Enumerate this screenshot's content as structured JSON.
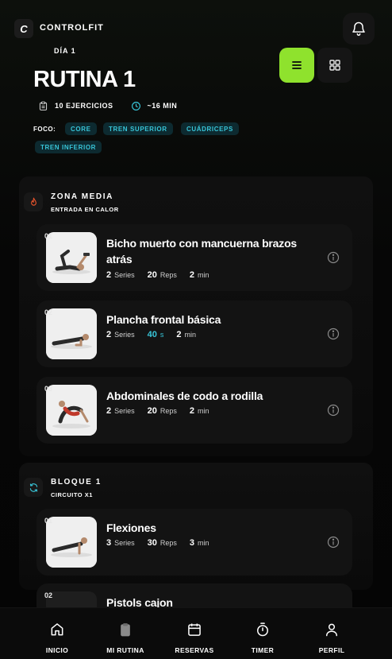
{
  "app": {
    "logo_letter": "C",
    "brand": "CONTROLFIT"
  },
  "header": {
    "day_label": "DÍA 1",
    "title": "RUTINA 1",
    "exercises_count": "10 EJERCICIOS",
    "duration": "~16 MIN",
    "focus_label": "FOCO:",
    "focus_tags": [
      "CORE",
      "TREN SUPERIOR",
      "CUÁDRICEPS",
      "TREN INFERIOR"
    ]
  },
  "view_toggle": {
    "active": "list",
    "options": [
      "list-icon",
      "grid-icon"
    ]
  },
  "sections": [
    {
      "icon": "flame-icon",
      "icon_color": "#e8532c",
      "title": "ZONA MEDIA",
      "subtitle": "ENTRADA EN CALOR",
      "exercises": [
        {
          "number": "01",
          "name": "Bicho muerto con mancuerna brazos atrás",
          "series": "2",
          "series_unit": "Series",
          "reps": "20",
          "reps_unit": "Reps",
          "rest": "2",
          "rest_unit": "min",
          "timed": false
        },
        {
          "number": "02",
          "name": "Plancha frontal básica",
          "series": "2",
          "series_unit": "Series",
          "reps": "40",
          "reps_unit": "s",
          "rest": "2",
          "rest_unit": "min",
          "timed": true
        },
        {
          "number": "03",
          "name": "Abdominales de codo a rodilla",
          "series": "2",
          "series_unit": "Series",
          "reps": "20",
          "reps_unit": "Reps",
          "rest": "2",
          "rest_unit": "min",
          "timed": false
        }
      ]
    },
    {
      "icon": "cycle-icon",
      "icon_color": "#38c6d9",
      "title": "BLOQUE 1",
      "subtitle": "CIRCUITO X1",
      "exercises": [
        {
          "number": "01",
          "name": "Flexiones",
          "series": "3",
          "series_unit": "Series",
          "reps": "30",
          "reps_unit": "Reps",
          "rest": "3",
          "rest_unit": "min",
          "timed": false
        },
        {
          "number": "02",
          "name": "Pistols cajon"
        }
      ]
    }
  ],
  "bottom_nav": [
    {
      "label": "INICIO",
      "icon": "home-icon"
    },
    {
      "label": "MI RUTINA",
      "icon": "clipboard-icon"
    },
    {
      "label": "RESERVAS",
      "icon": "calendar-icon"
    },
    {
      "label": "TIMER",
      "icon": "stopwatch-icon"
    },
    {
      "label": "PERFIL",
      "icon": "user-icon"
    }
  ],
  "colors": {
    "accent_green": "#8fe22d",
    "accent_cyan": "#38c6d9",
    "background": "#050505"
  }
}
